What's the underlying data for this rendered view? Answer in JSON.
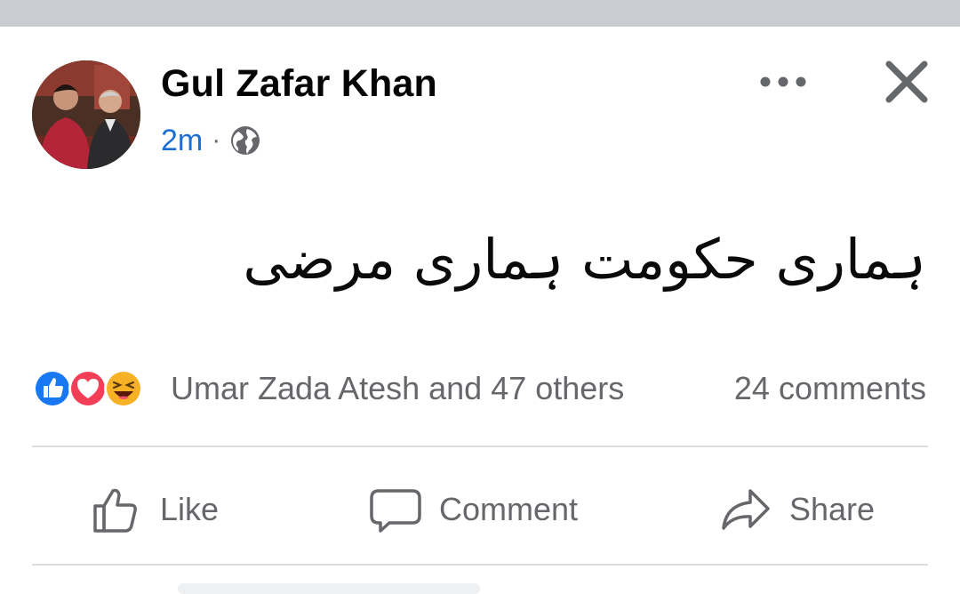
{
  "post": {
    "author": "Gul Zafar Khan",
    "time": "2m",
    "separator": "·",
    "audience_icon": "globe-icon",
    "text": "ہماری حکومت ہماری مرضی"
  },
  "reactions": {
    "icons": [
      "like-reaction-icon",
      "love-reaction-icon",
      "haha-reaction-icon"
    ],
    "summary": "Umar Zada Atesh and 47 others",
    "comments": "24 comments"
  },
  "actions": {
    "like": "Like",
    "comment": "Comment",
    "share": "Share"
  },
  "colors": {
    "accent_blue": "#1877f2",
    "time_blue": "#1c6fd1",
    "muted_text": "#65676b",
    "love_red": "#f33e58",
    "haha_yellow": "#f7b125"
  }
}
